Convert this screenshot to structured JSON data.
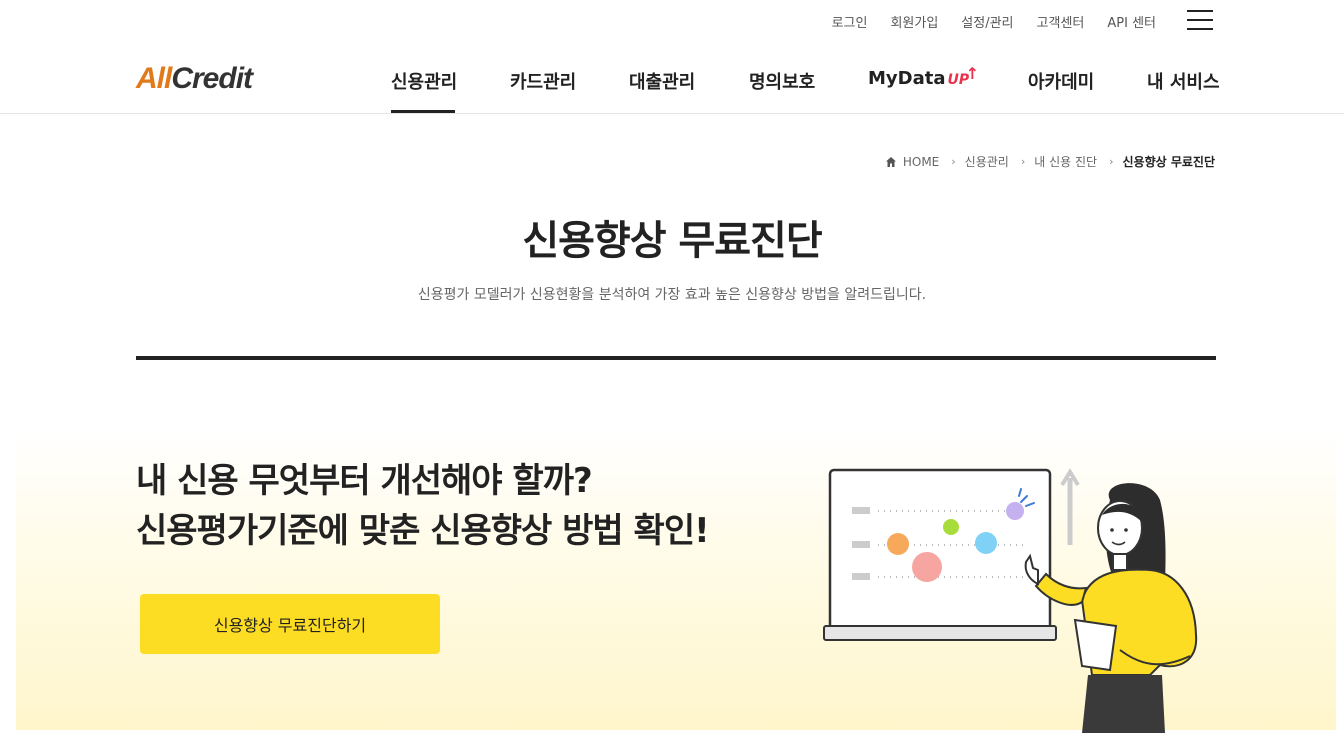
{
  "util_nav": [
    "로그인",
    "회원가입",
    "설정/관리",
    "고객센터",
    "API 센터"
  ],
  "logo": {
    "part1": "All",
    "part2": "Credit"
  },
  "gnb": {
    "items": [
      "신용관리",
      "카드관리",
      "대출관리",
      "명의보호",
      "MyData",
      "아카데미",
      "내 서비스"
    ],
    "mydata_badge": "UP",
    "active": "신용관리"
  },
  "breadcrumb": [
    "HOME",
    "신용관리",
    "내 신용 진단",
    "신용향상 무료진단"
  ],
  "page": {
    "title": "신용향상 무료진단",
    "subtitle": "신용평가 모델러가 신용현황을 분석하여 가장 효과 높은 신용향상 방법을 알려드립니다."
  },
  "banner": {
    "line1": "내 신용 무엇부터 개선해야 할까?",
    "line2": "신용평가기준에 맞춘 신용향상 방법 확인!",
    "cta_label": "신용향상 무료진단하기"
  },
  "colors": {
    "accent": "#fddd23",
    "brand_orange": "#e17a1a",
    "mydata_red": "#e8344e"
  }
}
